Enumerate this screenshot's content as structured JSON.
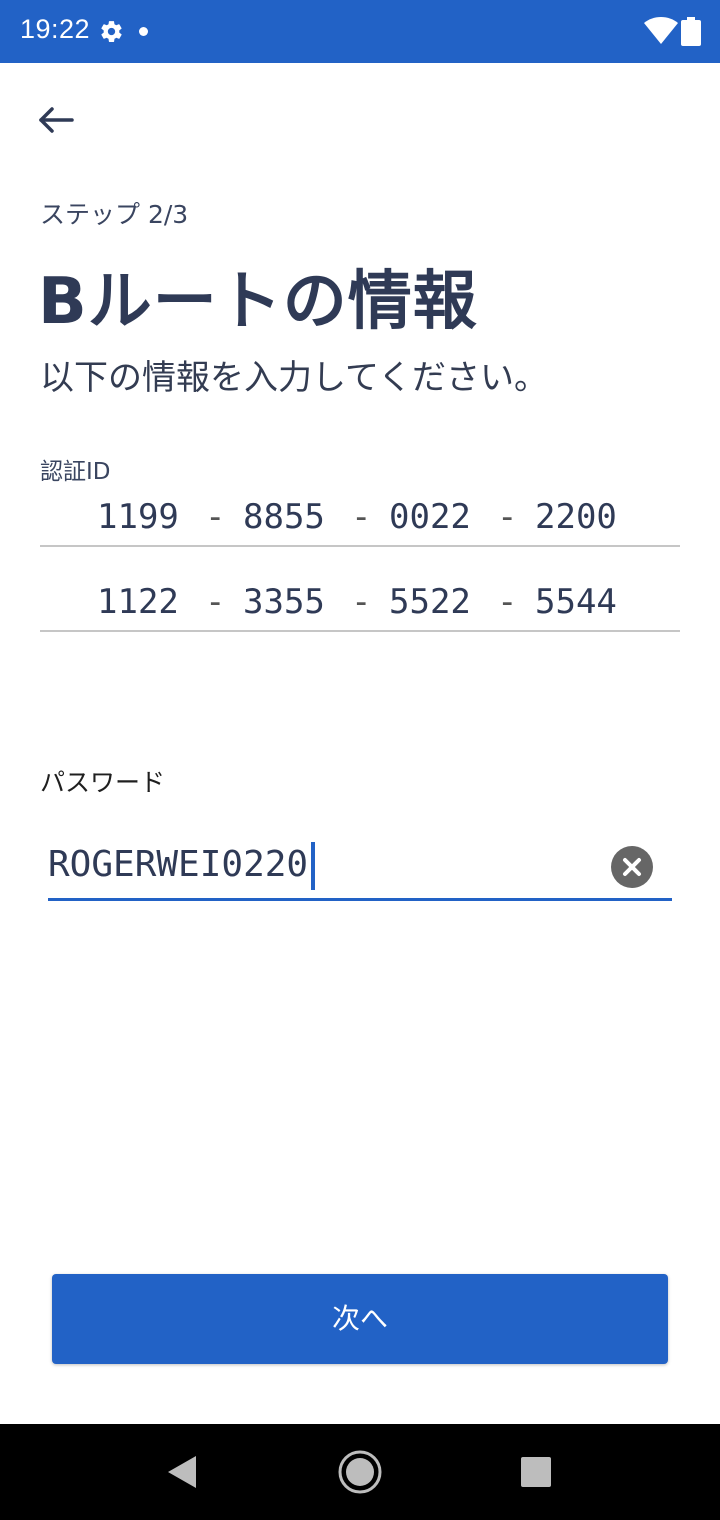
{
  "status_bar": {
    "time": "19:22",
    "icons": [
      "gear-icon",
      "notification-dot-icon",
      "wifi-icon",
      "battery-icon"
    ],
    "background_color": "#2262c6"
  },
  "header": {
    "back_icon": "arrow-left-icon",
    "step": "ステップ 2/3",
    "title": "Bルートの情報",
    "subtitle": "以下の情報を入力してください。"
  },
  "auth_id": {
    "label": "認証ID",
    "rows": [
      {
        "segments": [
          "1199",
          "8855",
          "0022",
          "2200"
        ]
      },
      {
        "segments": [
          "1122",
          "3355",
          "5522",
          "5544"
        ]
      }
    ],
    "separator": "-"
  },
  "password": {
    "label": "パスワード",
    "value": "ROGERWEI0220",
    "clear_icon": "clear-circle-icon"
  },
  "actions": {
    "next_label": "次へ",
    "accent_color": "#2262c6"
  },
  "nav_bar": {
    "icons": [
      "nav-back-icon",
      "nav-home-icon",
      "nav-recents-icon"
    ]
  }
}
